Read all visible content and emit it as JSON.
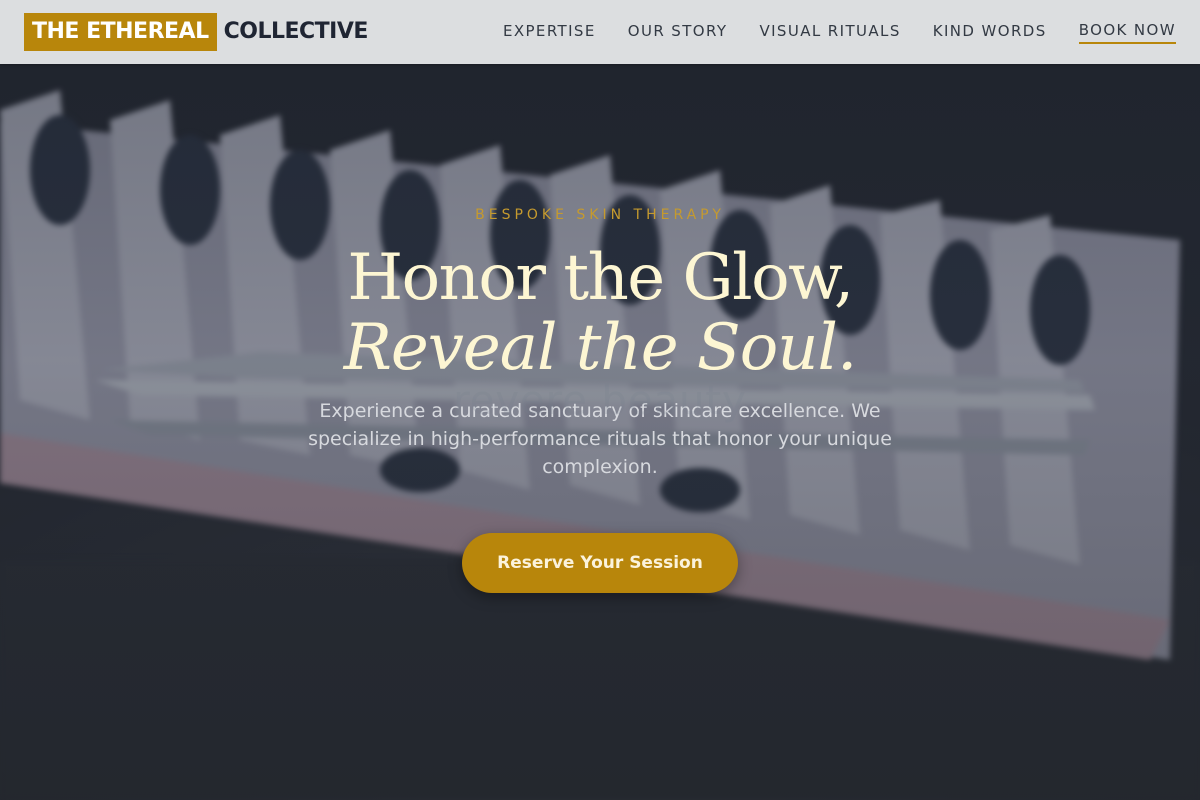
{
  "logo": {
    "primary": "THE ETHEREAL",
    "secondary": "COLLECTIVE"
  },
  "nav": {
    "items": [
      {
        "label": "EXPERTISE"
      },
      {
        "label": "OUR STORY"
      },
      {
        "label": "VISUAL RITUALS"
      },
      {
        "label": "KIND WORDS"
      },
      {
        "label": "BOOK NOW"
      }
    ]
  },
  "hero": {
    "eyebrow": "BESPOKE SKIN THERAPY",
    "headline_line1": "Honor the Glow,",
    "headline_line2": "Reveal the Soul.",
    "background_text": "revere beauty",
    "description": "Experience a curated sanctuary of skincare excellence. We specialize in high-performance rituals that honor your unique complexion.",
    "cta_label": "Reserve Your Session"
  },
  "colors": {
    "accent_gold": "#b8860b",
    "headline_cream": "#fdf6d3",
    "nav_text": "#333a44",
    "header_bg": "#e2e4e6"
  }
}
